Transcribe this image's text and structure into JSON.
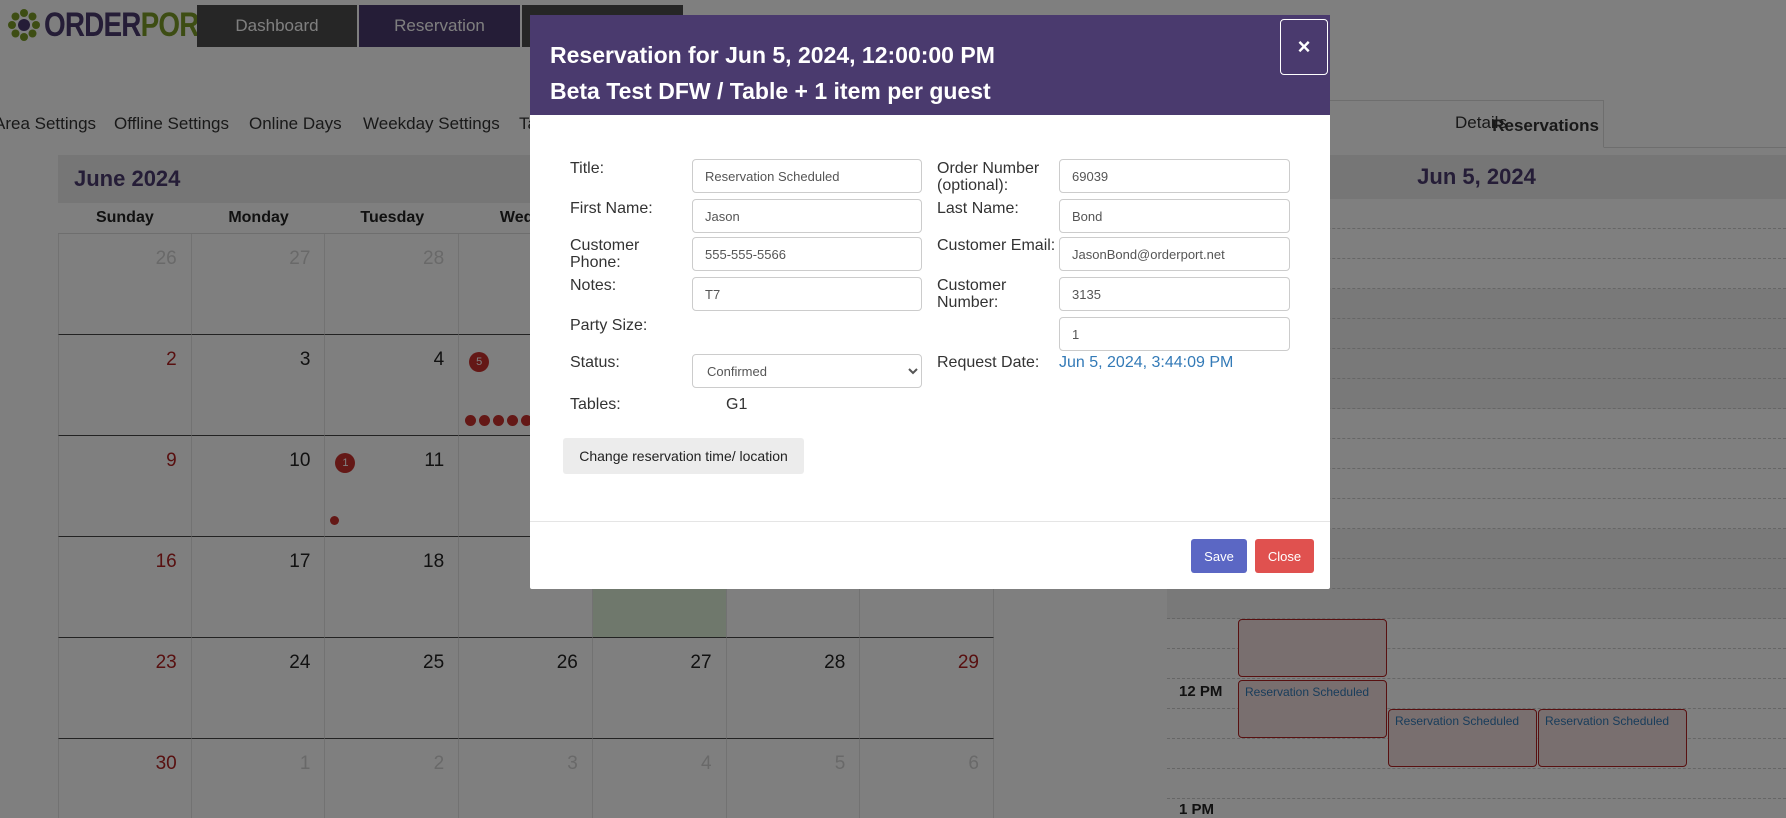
{
  "header": {
    "logo_part1": "ORDER",
    "logo_part2": "PORT",
    "nav": [
      "Dashboard",
      "Reservation",
      ""
    ],
    "colors": {
      "brand_purple": "#4a3a6e",
      "brand_green": "#7a9a26",
      "nav_gray": "#4d4d4d"
    }
  },
  "subtabs": [
    "Area Settings",
    "Offline Settings",
    "Online Days",
    "Weekday Settings",
    "Ta"
  ],
  "right_tabs": {
    "active": "Reservations",
    "details": "Details"
  },
  "calendar": {
    "month_title": "June 2024",
    "weekdays": [
      "Sunday",
      "Monday",
      "Tuesday",
      "Wedne",
      "",
      "",
      ""
    ],
    "weeks": [
      [
        "26",
        "27",
        "28",
        "",
        "",
        "",
        ""
      ],
      [
        "2",
        "3",
        "4",
        "",
        "",
        "",
        ""
      ],
      [
        "9",
        "10",
        "11",
        "",
        "",
        "",
        ""
      ],
      [
        "16",
        "17",
        "18",
        "",
        "",
        "",
        ""
      ],
      [
        "23",
        "24",
        "25",
        "26",
        "27",
        "28",
        "29"
      ],
      [
        "30",
        "1",
        "2",
        "3",
        "4",
        "5",
        "6"
      ]
    ],
    "badges": {
      "june5": "5",
      "june11": "1"
    }
  },
  "day_view": {
    "title": "Jun 5, 2024",
    "hours": {
      "noon": "12 PM",
      "one": "1 PM"
    },
    "events": [
      "",
      "Reservation Scheduled",
      "Reservation Scheduled",
      "Reservation Scheduled"
    ]
  },
  "modal": {
    "title_line1": "Reservation for Jun 5, 2024, 12:00:00 PM",
    "title_line2": "Beta Test DFW /   Table + 1 item per guest",
    "close_symbol": "×",
    "labels": {
      "title": "Title:",
      "order_number": "Order Number (optional):",
      "first_name": "First Name:",
      "last_name": "Last Name:",
      "customer_phone": "Customer Phone:",
      "customer_email": "Customer Email:",
      "notes": "Notes:",
      "customer_number": "Customer Number:",
      "party_size": "Party Size:",
      "status": "Status:",
      "request_date": "Request Date:",
      "tables": "Tables:"
    },
    "values": {
      "title": "Reservation Scheduled",
      "order_number": "69039",
      "first_name": "Jason",
      "last_name": "Bond",
      "customer_phone": "555-555-5566",
      "customer_email": "JasonBond@orderport.net",
      "notes": "T7",
      "customer_number": "3135",
      "party_size": "1",
      "status": "Confirmed",
      "request_date": "Jun 5, 2024, 3:44:09 PM",
      "tables": "G1"
    },
    "buttons": {
      "change": "Change reservation time/ location",
      "save": "Save",
      "close": "Close"
    },
    "colors": {
      "save": "#5b67c4",
      "close": "#e0514f",
      "link": "#337ab7"
    }
  }
}
